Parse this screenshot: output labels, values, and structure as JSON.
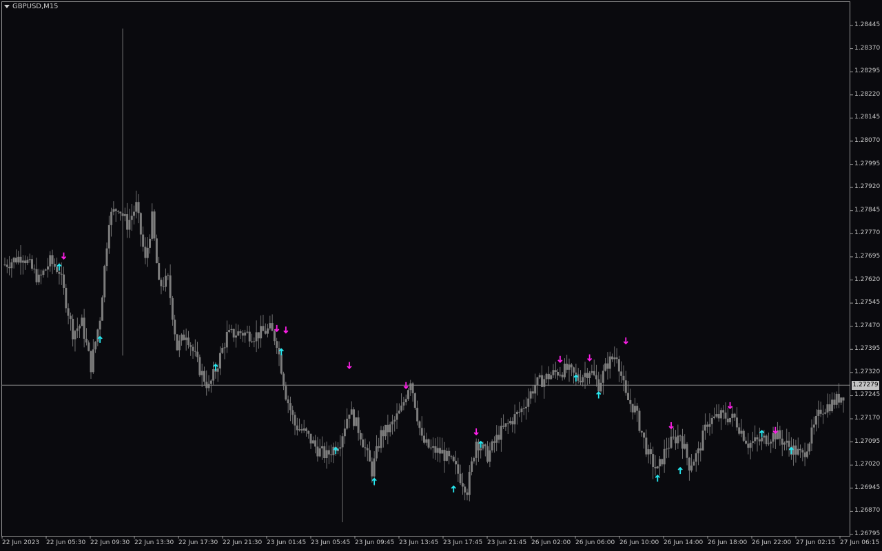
{
  "window": {
    "symbol_title": "GBPUSD,M15"
  },
  "colors": {
    "background": "#0a0a0e",
    "candle": "#7d7d7d",
    "wick": "#8a8a8a",
    "grid_line": "#9a9a9a",
    "up_arrow": "#26e8f0",
    "down_arrow": "#ff1fe8",
    "price_tag": "#c4c4c4"
  },
  "icons": {
    "menu": "triangle-down-icon",
    "buy_signal": "arrow-up-icon",
    "sell_signal": "arrow-down-icon"
  },
  "y_axis": {
    "ticks": [
      "1.28445",
      "1.28370",
      "1.28295",
      "1.28220",
      "1.28145",
      "1.28070",
      "1.27995",
      "1.27920",
      "1.27845",
      "1.27770",
      "1.27695",
      "1.27620",
      "1.27545",
      "1.27470",
      "1.27395",
      "1.27320",
      "1.27245",
      "1.27170",
      "1.27095",
      "1.27020",
      "1.26945",
      "1.26870",
      "1.26795"
    ],
    "current_price": "1.27279",
    "range": [
      1.26795,
      1.28445
    ]
  },
  "x_axis": {
    "ticks": [
      "22 Jun 2023",
      "22 Jun 05:30",
      "22 Jun 09:30",
      "22 Jun 13:30",
      "22 Jun 17:30",
      "22 Jun 21:30",
      "23 Jun 01:45",
      "23 Jun 05:45",
      "23 Jun 09:45",
      "23 Jun 13:45",
      "23 Jun 17:45",
      "23 Jun 21:45",
      "26 Jun 02:00",
      "26 Jun 06:00",
      "26 Jun 10:00",
      "26 Jun 14:00",
      "26 Jun 18:00",
      "26 Jun 22:00",
      "27 Jun 02:15",
      "27 Jun 06:15"
    ]
  },
  "chart_data": {
    "type": "candlestick",
    "symbol": "GBPUSD",
    "timeframe": "M15",
    "ylim": [
      1.26795,
      1.28445
    ],
    "last_price": 1.27279,
    "approx_close_path": [
      [
        0,
        1.2767
      ],
      [
        8,
        1.277
      ],
      [
        15,
        1.2762
      ],
      [
        20,
        1.2768
      ],
      [
        24,
        1.2765
      ],
      [
        30,
        1.2745
      ],
      [
        34,
        1.2748
      ],
      [
        38,
        1.2734
      ],
      [
        42,
        1.275
      ],
      [
        46,
        1.2782
      ],
      [
        50,
        1.2786
      ],
      [
        54,
        1.278
      ],
      [
        58,
        1.2786
      ],
      [
        62,
        1.2768
      ],
      [
        65,
        1.2782
      ],
      [
        68,
        1.276
      ],
      [
        72,
        1.2762
      ],
      [
        76,
        1.274
      ],
      [
        80,
        1.2745
      ],
      [
        86,
        1.2733
      ],
      [
        90,
        1.2727
      ],
      [
        94,
        1.2735
      ],
      [
        98,
        1.2744
      ],
      [
        104,
        1.2745
      ],
      [
        110,
        1.2744
      ],
      [
        117,
        1.2746
      ],
      [
        120,
        1.2742
      ],
      [
        124,
        1.2725
      ],
      [
        128,
        1.2715
      ],
      [
        133,
        1.2712
      ],
      [
        138,
        1.2707
      ],
      [
        142,
        1.2705
      ],
      [
        148,
        1.271
      ],
      [
        152,
        1.272
      ],
      [
        157,
        1.2712
      ],
      [
        162,
        1.27
      ],
      [
        166,
        1.2712
      ],
      [
        170,
        1.2714
      ],
      [
        175,
        1.272
      ],
      [
        179,
        1.273
      ],
      [
        184,
        1.271
      ],
      [
        188,
        1.2707
      ],
      [
        193,
        1.2706
      ],
      [
        198,
        1.2702
      ],
      [
        204,
        1.2694
      ],
      [
        208,
        1.271
      ],
      [
        213,
        1.2705
      ],
      [
        218,
        1.2712
      ],
      [
        223,
        1.2716
      ],
      [
        228,
        1.272
      ],
      [
        234,
        1.2728
      ],
      [
        238,
        1.273
      ],
      [
        243,
        1.2732
      ],
      [
        248,
        1.2733
      ],
      [
        253,
        1.273
      ],
      [
        258,
        1.2733
      ],
      [
        262,
        1.2728
      ],
      [
        266,
        1.2735
      ],
      [
        270,
        1.2738
      ],
      [
        274,
        1.2724
      ],
      [
        278,
        1.272
      ],
      [
        284,
        1.2705
      ],
      [
        288,
        1.27
      ],
      [
        292,
        1.2708
      ],
      [
        298,
        1.2712
      ],
      [
        302,
        1.2702
      ],
      [
        306,
        1.2706
      ],
      [
        310,
        1.2716
      ],
      [
        316,
        1.2718
      ],
      [
        322,
        1.2717
      ],
      [
        328,
        1.2709
      ],
      [
        334,
        1.271
      ],
      [
        340,
        1.2712
      ],
      [
        346,
        1.2708
      ],
      [
        352,
        1.2705
      ],
      [
        356,
        1.2712
      ],
      [
        360,
        1.272
      ],
      [
        365,
        1.2722
      ],
      [
        370,
        1.2725
      ]
    ],
    "signals": [
      {
        "type": "buy",
        "time_index": 24,
        "price": 1.2766
      },
      {
        "type": "sell",
        "time_index": 26,
        "price": 1.277
      },
      {
        "type": "buy",
        "time_index": 42,
        "price": 1.27425
      },
      {
        "type": "buy",
        "time_index": 93,
        "price": 1.27335
      },
      {
        "type": "sell",
        "time_index": 120,
        "price": 1.27465
      },
      {
        "type": "sell",
        "time_index": 124,
        "price": 1.2746
      },
      {
        "type": "buy",
        "time_index": 122,
        "price": 1.27385
      },
      {
        "type": "sell",
        "time_index": 152,
        "price": 1.27345
      },
      {
        "type": "buy",
        "time_index": 146,
        "price": 1.27065
      },
      {
        "type": "buy",
        "time_index": 163,
        "price": 1.26965
      },
      {
        "type": "sell",
        "time_index": 177,
        "price": 1.2728
      },
      {
        "type": "buy",
        "time_index": 198,
        "price": 1.2694
      },
      {
        "type": "sell",
        "time_index": 208,
        "price": 1.2713
      },
      {
        "type": "buy",
        "time_index": 210,
        "price": 1.27085
      },
      {
        "type": "sell",
        "time_index": 245,
        "price": 1.27365
      },
      {
        "type": "buy",
        "time_index": 252,
        "price": 1.273
      },
      {
        "type": "sell",
        "time_index": 258,
        "price": 1.2737
      },
      {
        "type": "buy",
        "time_index": 262,
        "price": 1.27245
      },
      {
        "type": "sell",
        "time_index": 274,
        "price": 1.27425
      },
      {
        "type": "buy",
        "time_index": 288,
        "price": 1.26975
      },
      {
        "type": "sell",
        "time_index": 294,
        "price": 1.2715
      },
      {
        "type": "buy",
        "time_index": 298,
        "price": 1.27
      },
      {
        "type": "sell",
        "time_index": 320,
        "price": 1.27215
      },
      {
        "type": "buy",
        "time_index": 334,
        "price": 1.2712
      },
      {
        "type": "sell",
        "time_index": 340,
        "price": 1.27135
      },
      {
        "type": "buy",
        "time_index": 347,
        "price": 1.27065
      }
    ]
  }
}
